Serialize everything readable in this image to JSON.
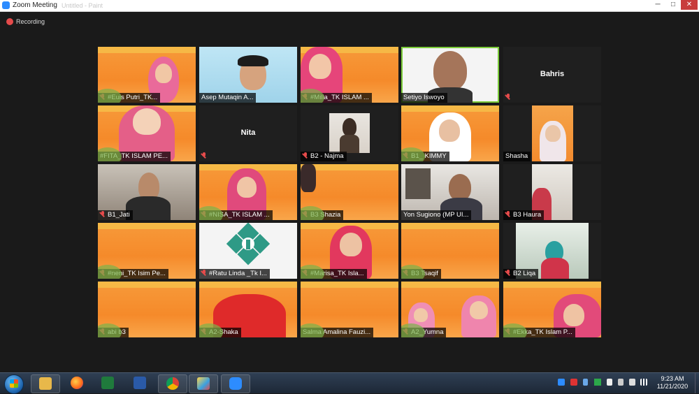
{
  "window": {
    "title": "Zoom Meeting",
    "inactive_tab": "Untitled - Paint",
    "minimize": "─",
    "maximize": "□",
    "close": "✕"
  },
  "recording": {
    "label": "Recording"
  },
  "participants": [
    {
      "name": "#Euis Putri_TK...",
      "muted": true
    },
    {
      "name": "Asep Mutaqin A...",
      "muted": false
    },
    {
      "name": "#Milla_TK ISLAM ...",
      "muted": true
    },
    {
      "name": "Setiyo Iswoyo",
      "muted": false,
      "active_speaker": true
    },
    {
      "name": "Bahris",
      "muted": true,
      "video_off": true
    },
    {
      "name": "#FITA_TK ISLAM PE...",
      "muted": false
    },
    {
      "name": "Nita",
      "muted": true,
      "video_off": true
    },
    {
      "name": "B2 - Najma",
      "muted": true
    },
    {
      "name": "B1_ KIMMY",
      "muted": true
    },
    {
      "name": "Shasha",
      "muted": false
    },
    {
      "name": "B1_Jati",
      "muted": true
    },
    {
      "name": "#NISA_TK ISLAM ...",
      "muted": true
    },
    {
      "name": "B3 Shazia",
      "muted": true
    },
    {
      "name": "Yon Sugiono (MP UI...",
      "muted": false
    },
    {
      "name": "B3 Haura",
      "muted": true
    },
    {
      "name": "#neni_TK Isim Pe...",
      "muted": true
    },
    {
      "name": "#Ratu Linda _Tk I...",
      "muted": true
    },
    {
      "name": "#Marisa_TK Isla...",
      "muted": true
    },
    {
      "name": "B3 Tsaqif",
      "muted": true
    },
    {
      "name": "B2 Liqa",
      "muted": true
    },
    {
      "name": "abi b3",
      "muted": true
    },
    {
      "name": "A2-Shaka",
      "muted": true
    },
    {
      "name": "Salma Amalina Fauzi...",
      "muted": false
    },
    {
      "name": "A2_Yumna",
      "muted": true
    },
    {
      "name": "#Ekka_TK Islam P...",
      "muted": true
    }
  ],
  "taskbar": {
    "apps": [
      "windows-explorer-icon",
      "firefox-icon",
      "excel-icon",
      "word-icon",
      "chrome-icon",
      "paint-icon",
      "zoom-icon"
    ],
    "clock_time": "9:23 AM",
    "clock_date": "11/21/2020"
  },
  "colors": {
    "accent": "#2d8cff",
    "active_speaker": "#7ccc3a",
    "muted": "#e54b4b",
    "banner": "#f58a2a"
  }
}
